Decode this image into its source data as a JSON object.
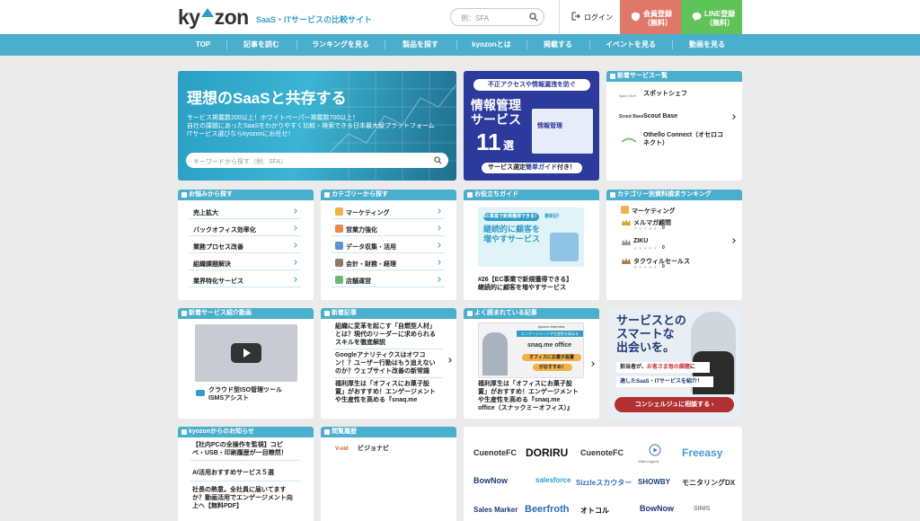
{
  "header": {
    "logo": "ky",
    "logo_tail": "zon",
    "tagline": "SaaS・ITサービスの比較サイト",
    "search_placeholder": "例：SFA",
    "login": "ログイン",
    "register": "会員登録\n（無料）",
    "line": "LINE登録\n（無料）"
  },
  "nav": [
    "TOP",
    "記事を読む",
    "ランキングを見る",
    "製品を探す",
    "kyozonとは",
    "掲載する",
    "イベントを見る",
    "動画を見る"
  ],
  "hero": {
    "title": "理想のSaaSと共存する",
    "desc": "サービス掲載数200以上！ホワイトペーパー掲載数700以上！\n自社の課題にあったSaaSをわかりやすく比較・検索できる日本最大級プラットフォーム\nITサービス選びならkyozonにお任せ！",
    "search_placeholder": "キーワードから探す（例：SFA）"
  },
  "ad_security": {
    "top": "不正アクセスや情報漏洩を防ぐ",
    "l1": "情報管理",
    "l2": "サービス",
    "num": "11",
    "unit": "選",
    "mock": "情報管理",
    "bottom_a": "サービス選定",
    "bottom_b": "簡単ガイド",
    "bottom_c": "付き！"
  },
  "new_services": {
    "header": "新着サービス一覧",
    "items": [
      {
        "logo": "Spot Chef",
        "name": "スポットシェフ"
      },
      {
        "logo": "Scout Base",
        "name": "Scout Base"
      },
      {
        "logo": "",
        "name": "Othello Connect（オセロコ\nネクト）"
      }
    ]
  },
  "worry": {
    "header": "お悩みから探す",
    "items": [
      "売上拡大",
      "バックオフィス効率化",
      "業務プロセス改善",
      "組織課題解決",
      "業界特化サービス"
    ]
  },
  "category": {
    "header": "カテゴリーから探す",
    "items": [
      "マーケティング",
      "営業力強化",
      "データ収集・活用",
      "会計・財務・経理",
      "店舗運営"
    ]
  },
  "guide": {
    "header": "お役立ちガイド",
    "badge": "EC事業で新規獲得できる！",
    "sub": "最新記!",
    "t1": "継続的に顧客を",
    "t2": "増やすサービス",
    "caption": "#26【EC事業で新規獲得できる】\n継続的に顧客を増やすサービス"
  },
  "ranking": {
    "header": "カテゴリー別資料請求ランキング",
    "category": "マーケティング",
    "items": [
      {
        "name": "メルマガ顧問",
        "score": "0"
      },
      {
        "name": "ZIKU",
        "score": "0"
      },
      {
        "name": "タクウィルセールス",
        "score": "0"
      }
    ]
  },
  "video": {
    "header": "新着サービス紹介動画",
    "title": "クラウド型ISO管理ツール\nISMSアシスト"
  },
  "news": {
    "header": "新着記事",
    "items": [
      "組織に変革を起こす「自燃型人材」\nとは？現代のリーダーに求められる\nスキルを徹底解説",
      "Googleアナリティクスはオワコ\nン！？ユーザー行動はもう追えない\nのか？ウェブサイト改善の新常識",
      "福利厚生は「オフィスにお菓子設\n置」がおすすめ！エンゲージメント\nや生産性を高める『snaq.me"
    ]
  },
  "popular": {
    "header": "よく読まれている記事",
    "brand": "kyozon interview",
    "banner": "エンゲージメントや生産性を高める",
    "word": "snaq.me office",
    "pill1": "オフィスにお菓子設置",
    "pill2": "がおすすめ！",
    "caption": "福利厚生は「オフィスにお菓子設\n置」がおすすめ！エンゲージメント\nや生産性を高める『snaq.me\noffice（スナックミーオフィス）』"
  },
  "concierge": {
    "t1": "サービスとの",
    "t2": "スマートな",
    "t3": "出会いを。",
    "b1a": "担当者が、",
    "b1b": "お客さま毎の課題",
    "b1c": "に",
    "b2": "適したSaaS・ITサービスを紹介！",
    "btn": "コンシェルジュに相談する ›"
  },
  "notice": {
    "header": "kyozonからのお知らせ",
    "items": [
      "【社内PCの全操作を監視】コピ\nペ・USB・印刷履歴が一目瞭然！",
      "AI活用おすすめサービス５選",
      "社長の熱意。全社員に届いてます\nか？動画活用でエンゲージメント向\n上へ【無料PDF】"
    ]
  },
  "history": {
    "header": "閲覧履歴",
    "logo": "V-old",
    "name": "ビジョナビ"
  },
  "logos": [
    "CuenoteFC",
    "DORIRU",
    "CuenoteFC",
    "Video Agent",
    "Freeasy",
    "BowNow",
    "salesforce",
    "Sizzleスカウター",
    "SHOWBY",
    "モニタリングDX",
    "Sales Marker",
    "Beerfroth",
    "オトコル",
    "BowNow",
    "SINIS"
  ],
  "colors": {
    "accent": "#4aaecd",
    "register": "#e0786a",
    "line": "#5fc35a",
    "navy": "#2c3a9c",
    "red": "#c8343a"
  }
}
